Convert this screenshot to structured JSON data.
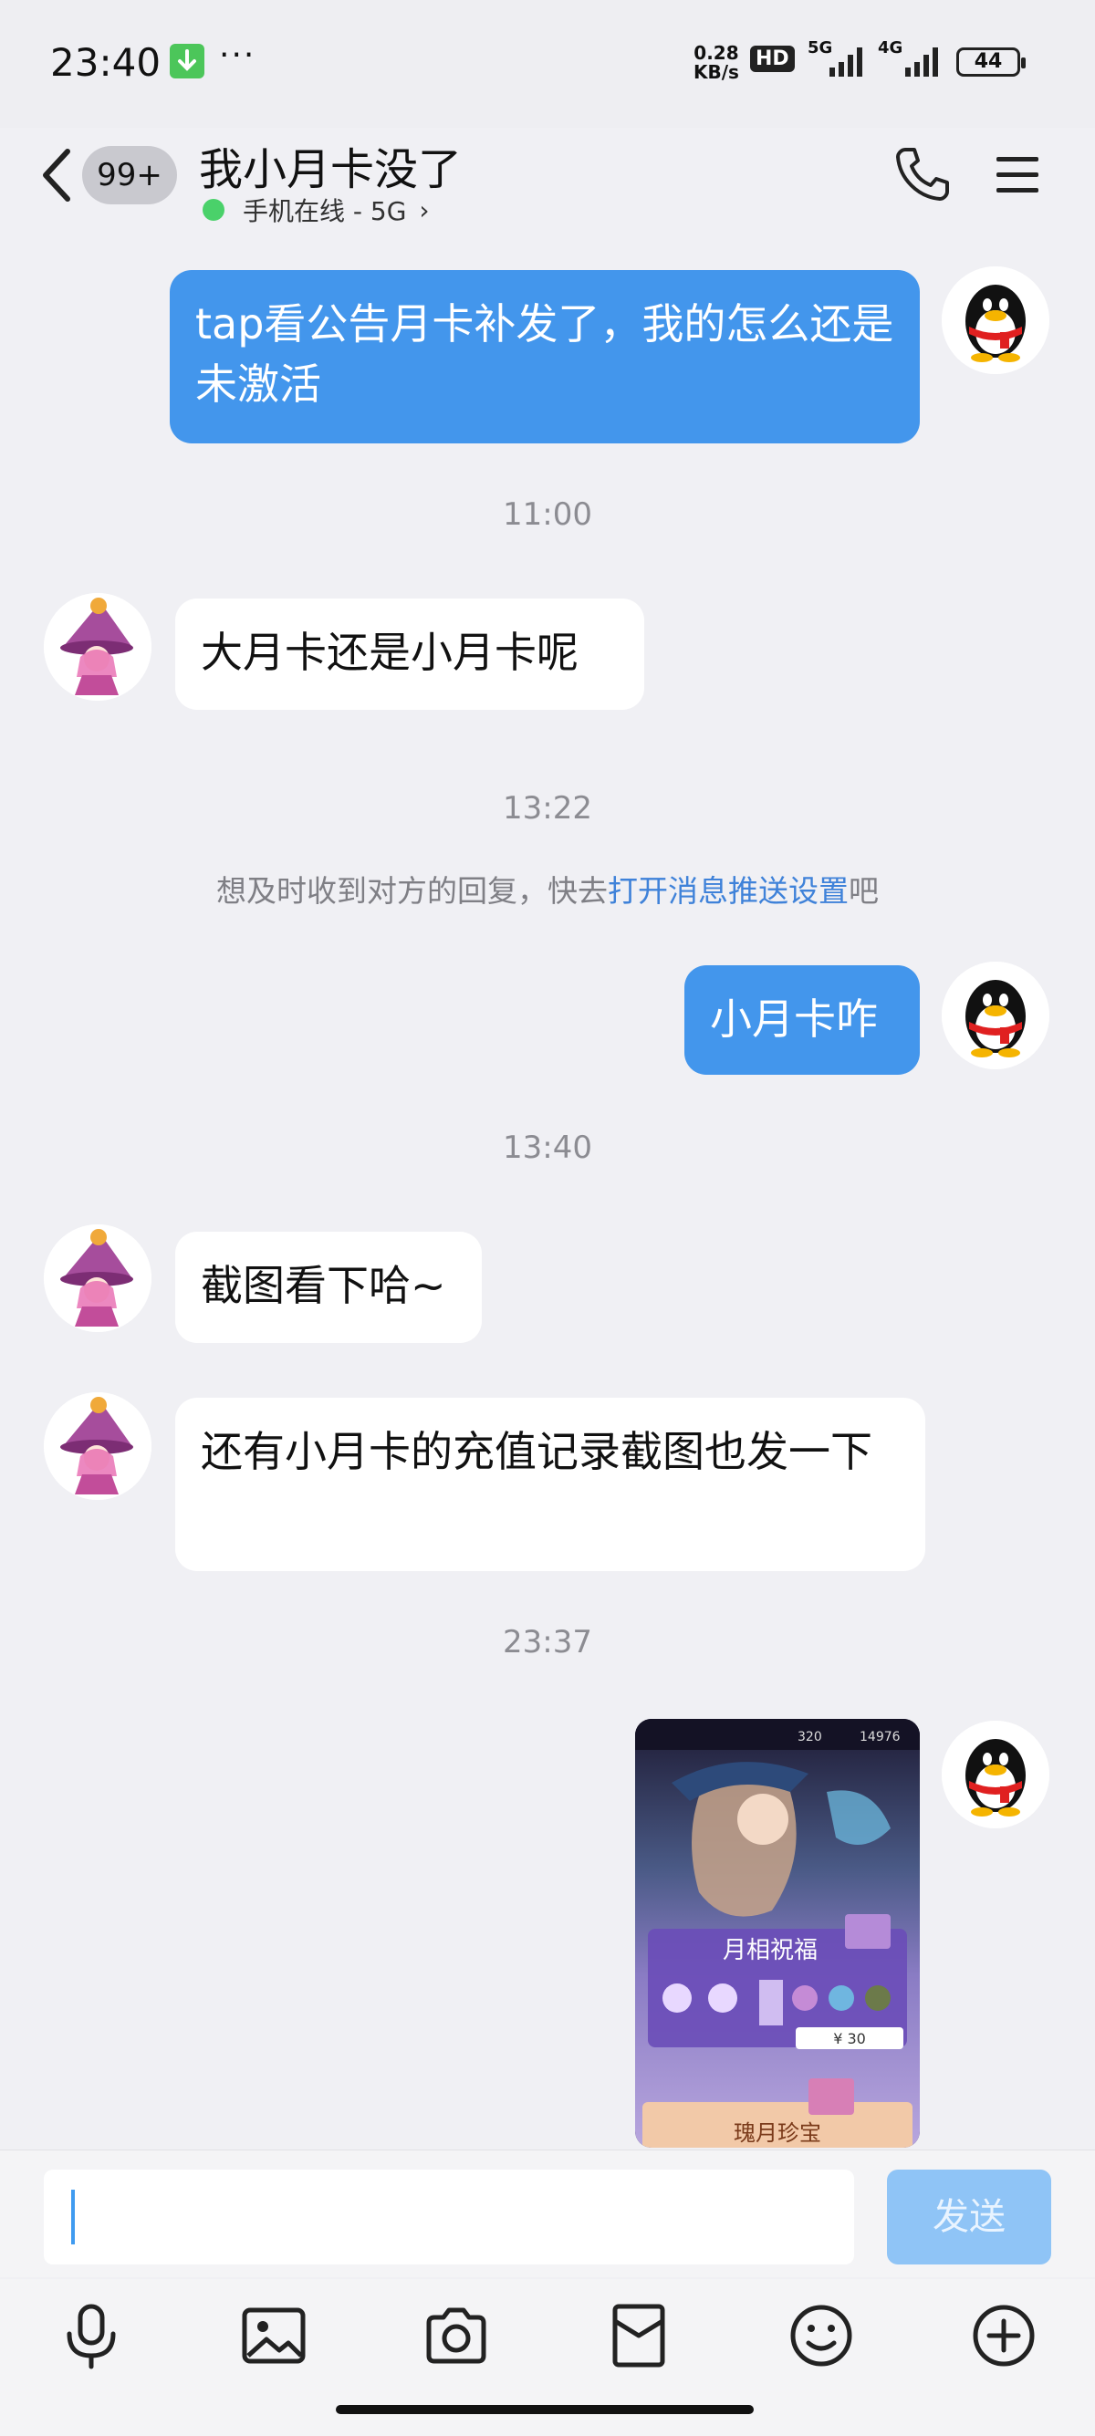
{
  "status_bar": {
    "time": "23:40",
    "more": "···",
    "speed_value": "0.28",
    "speed_unit": "KB/s",
    "hd_label": "HD",
    "net1": "5G",
    "net2": "4G",
    "battery": "44"
  },
  "header": {
    "unread_badge": "99+",
    "title": "我小月卡没了",
    "status_text": "手机在线 - 5G",
    "status_chevron": "›",
    "online_color": "#4ad16a"
  },
  "messages": [
    {
      "side": "out",
      "text": "tap看公告月卡补发了，我的怎么还是未激活"
    },
    {
      "timestamp": "11:00"
    },
    {
      "side": "in",
      "text": "大月卡还是小月卡呢"
    },
    {
      "timestamp": "13:22"
    },
    {
      "notice_prefix": "想及时收到对方的回复，快去",
      "notice_link": "打开消息推送设置",
      "notice_suffix": "吧"
    },
    {
      "side": "out",
      "text": "小月卡咋"
    },
    {
      "timestamp": "13:40"
    },
    {
      "side": "in",
      "text": "截图看下哈~"
    },
    {
      "side": "in",
      "text": "还有小月卡的充值记录截图也发一下"
    },
    {
      "timestamp": "23:37"
    },
    {
      "side": "out",
      "type": "image",
      "img_topbar_a": "320",
      "img_topbar_b": "14976",
      "img_title": "月相祝福",
      "img_price": "¥ 30",
      "img_title2": "瑰月珍宝"
    }
  ],
  "input": {
    "placeholder": "",
    "value": "",
    "send_label": "发送"
  },
  "toolbar": {
    "icons": [
      "microphone-icon",
      "image-icon",
      "camera-icon",
      "red-packet-icon",
      "emoji-icon",
      "plus-icon"
    ]
  },
  "colors": {
    "outgoing_bubble": "#4396ec",
    "incoming_bubble": "#ffffff",
    "background": "#f0f0f4",
    "link": "#3f82d9",
    "send_disabled": "#8fc4f6"
  }
}
